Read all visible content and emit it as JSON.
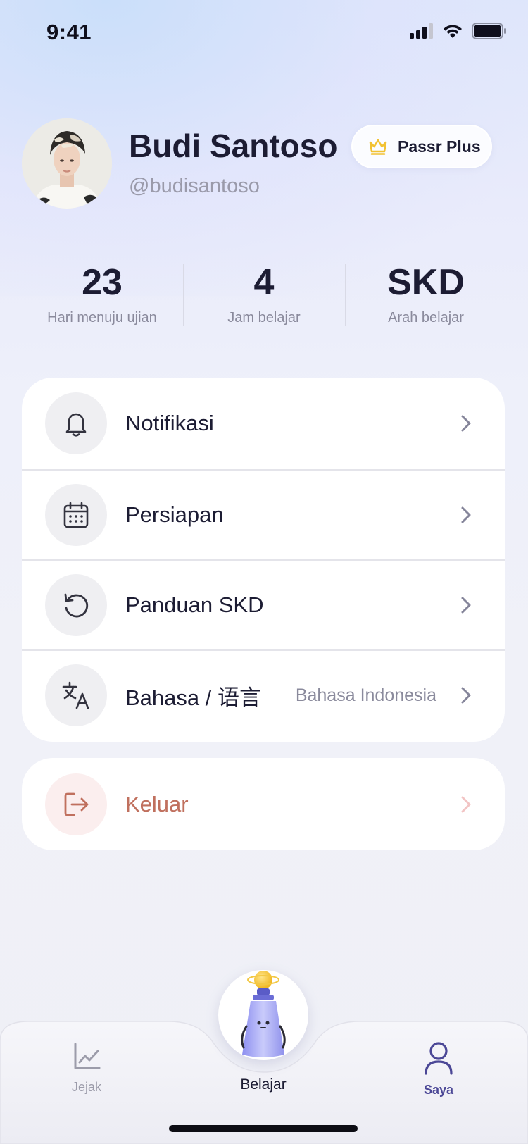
{
  "status_bar": {
    "time": "9:41"
  },
  "profile": {
    "name": "Budi Santoso",
    "handle": "@budisantoso",
    "badge_label": "Passr Plus"
  },
  "stats": [
    {
      "value": "23",
      "label": "Hari menuju ujian"
    },
    {
      "value": "4",
      "label": "Jam belajar"
    },
    {
      "value": "SKD",
      "label": "Arah belajar"
    }
  ],
  "menu": {
    "items": [
      {
        "label": "Notifikasi",
        "icon": "bell-icon"
      },
      {
        "label": "Persiapan",
        "icon": "calendar-icon"
      },
      {
        "label": "Panduan SKD",
        "icon": "refresh-icon"
      },
      {
        "label": "Bahasa / 语言",
        "value": "Bahasa Indonesia",
        "icon": "translate-icon"
      }
    ]
  },
  "logout": {
    "label": "Keluar",
    "icon": "logout-icon"
  },
  "tab_bar": {
    "tabs": [
      {
        "label": "Jejak",
        "icon": "chart-icon"
      },
      {
        "label": "Belajar",
        "icon": "mascot-icon"
      },
      {
        "label": "Saya",
        "icon": "user-icon"
      }
    ]
  },
  "colors": {
    "text_primary": "#1c1c33",
    "text_secondary": "#8a8a9c",
    "accent": "#4b4796",
    "logout": "#c0705e",
    "badge_crown": "#f2c233"
  }
}
